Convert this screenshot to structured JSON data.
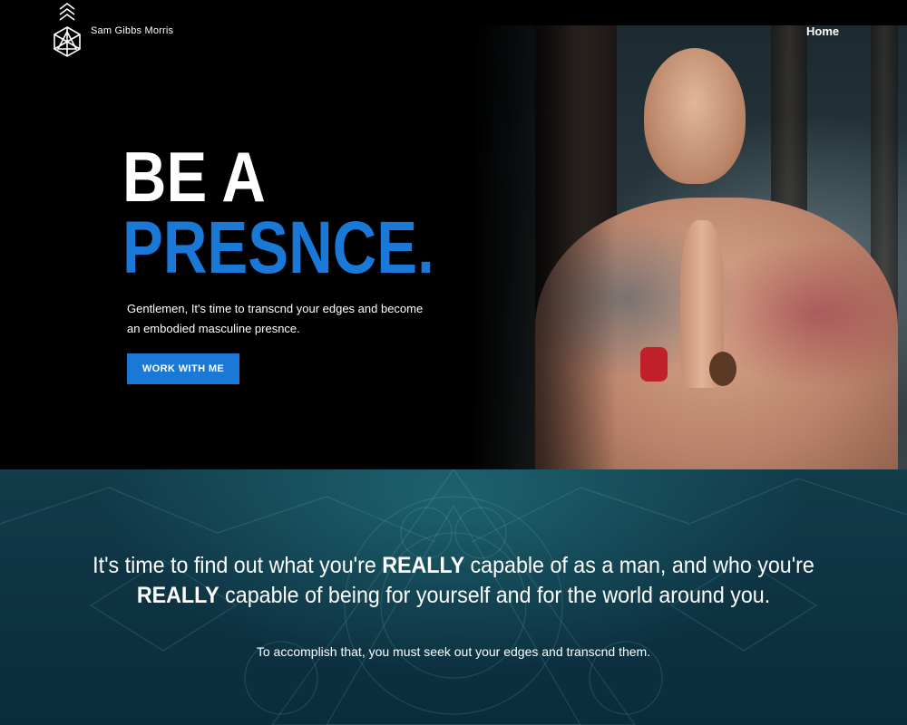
{
  "brand": {
    "name": "Sam Gibbs Morris",
    "logo_icon": "sacred-geometry-arrows-icon"
  },
  "nav": {
    "home_label": "Home"
  },
  "hero": {
    "headline_line1": "BE A",
    "headline_line2": "PRESNCE.",
    "subtext": "Gentlemen, It's time to transcnd your edges and become an embodied masculine presnce.",
    "cta_label": "WORK WITH ME",
    "accent_color": "#1a78d6"
  },
  "statement": {
    "part1": "It's time to find out what you're ",
    "emph1": "REALLY",
    "part2": " capable of as a man, and who you're ",
    "emph2": "REALLY",
    "part3": " capable of being for yourself and for the world around you."
  },
  "accomplish": "To accomplish that, you must seek out your edges and transcnd them."
}
